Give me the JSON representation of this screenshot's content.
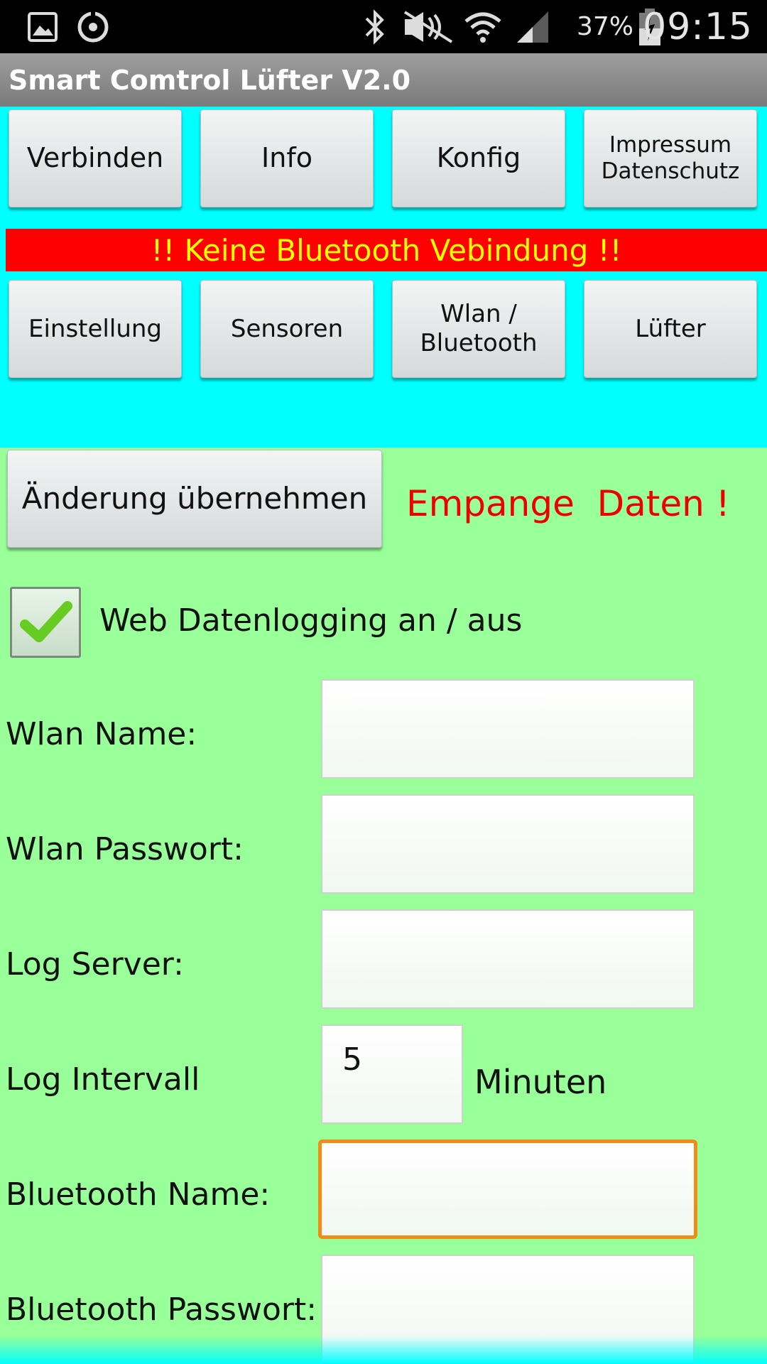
{
  "status_bar": {
    "battery": "37%",
    "time": "09:15",
    "icons": [
      "gallery-icon",
      "sync-icon",
      "bluetooth-icon",
      "mute-icon",
      "wifi-icon",
      "signal-icon",
      "battery-icon"
    ]
  },
  "app": {
    "title": "Smart Comtrol Lüfter V2.0"
  },
  "nav_top": [
    {
      "label": "Verbinden"
    },
    {
      "label": "Info"
    },
    {
      "label": "Konfig"
    },
    {
      "label": "Impressum\nDatenschutz"
    }
  ],
  "warning": "!! Keine Bluetooth Vebindung !!",
  "nav_bottom": [
    {
      "label": "Einstellung"
    },
    {
      "label": "Sensoren"
    },
    {
      "label": "Wlan  /\nBluetooth"
    },
    {
      "label": "Lüfter"
    }
  ],
  "apply_button": "Änderung übernehmen",
  "receive_status": "Empange  Daten !",
  "web_logging": {
    "label": "Web Datenlogging an / aus",
    "checked": true
  },
  "form": {
    "wlan_name": {
      "label": "Wlan Name:",
      "value": ""
    },
    "wlan_password": {
      "label": "Wlan Passwort:",
      "value": ""
    },
    "log_server": {
      "label": "Log Server:",
      "value": ""
    },
    "log_interval": {
      "label": "Log Intervall",
      "value": "5",
      "unit": "Minuten"
    },
    "bt_name": {
      "label": "Bluetooth Name:",
      "value": ""
    },
    "bt_password": {
      "label": "Bluetooth Passwort:",
      "value": ""
    }
  },
  "colors": {
    "top_area": "#00ffff",
    "form_area": "#99ff99",
    "warning_bg": "#ff0000",
    "warning_text": "#ffff00",
    "status_text": "#ee0000",
    "focus_border": "#f28c16"
  }
}
